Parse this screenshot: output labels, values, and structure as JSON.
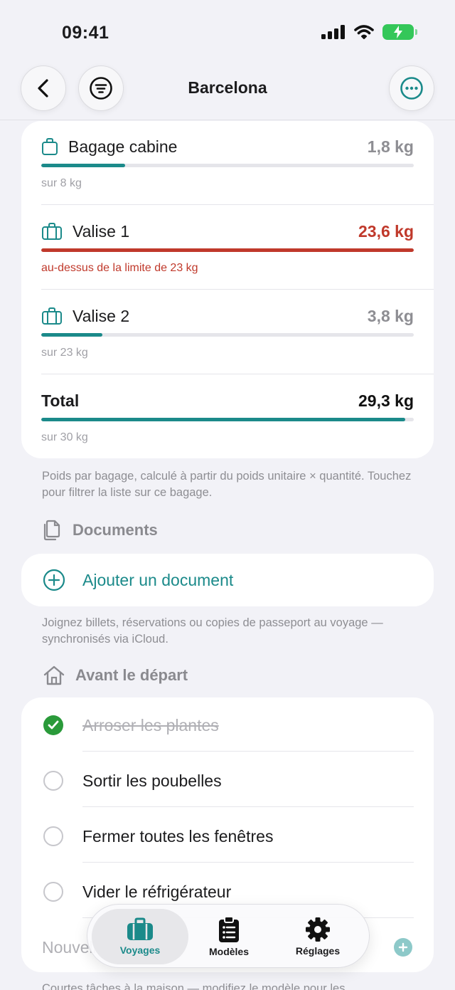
{
  "status": {
    "time": "09:41"
  },
  "nav": {
    "title": "Barcelona"
  },
  "bags": [
    {
      "name": "Bagage cabine",
      "weight": "1,8 kg",
      "sub": "sur 8 kg",
      "fill": 0.225,
      "over": false
    },
    {
      "name": "Valise 1",
      "weight": "23,6 kg",
      "sub": "au-dessus de la limite de 23 kg",
      "fill": 1.0,
      "over": true
    },
    {
      "name": "Valise 2",
      "weight": "3,8 kg",
      "sub": "sur 23 kg",
      "fill": 0.165,
      "over": false
    }
  ],
  "total": {
    "label": "Total",
    "weight": "29,3 kg",
    "sub": "sur 30 kg",
    "fill": 0.977
  },
  "weights_footnote": "Poids par bagage, calculé à partir du poids unitaire × quantité. Touchez pour filtrer la liste sur ce bagage.",
  "documents": {
    "heading": "Documents",
    "add_label": "Ajouter un document",
    "footnote": "Joignez billets, réservations ou copies de passeport au voyage — synchronisés via iCloud."
  },
  "before_departure": {
    "heading": "Avant le départ",
    "items": [
      {
        "label": "Arroser les plantes",
        "done": true
      },
      {
        "label": "Sortir les poubelles",
        "done": false
      },
      {
        "label": "Fermer toutes les fenêtres",
        "done": false
      },
      {
        "label": "Vider le réfrigérateur",
        "done": false
      }
    ],
    "new_placeholder": "Nouvelle tâche",
    "footnote": "Courtes tâches à la maison — modifiez le modèle pour les"
  },
  "tabs": [
    {
      "label": "Voyages",
      "icon": "suitcase-icon",
      "active": true
    },
    {
      "label": "Modèles",
      "icon": "clipboard-list-icon",
      "active": false
    },
    {
      "label": "Réglages",
      "icon": "gear-icon",
      "active": false
    }
  ],
  "colors": {
    "accent": "#1b8a8a",
    "danger": "#c0392b",
    "done": "#2a9a3a"
  }
}
